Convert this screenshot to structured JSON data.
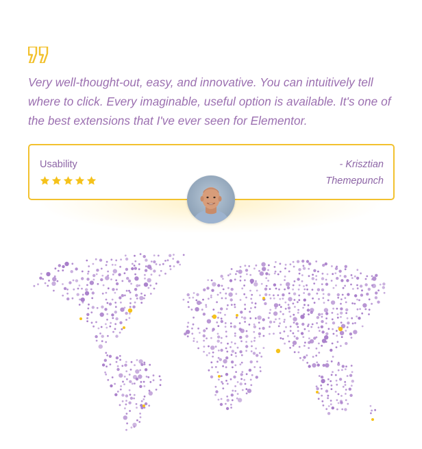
{
  "testimonial": {
    "quote_icon": "quote-mark-icon",
    "quote": "Very well-thought-out, easy, and innovative. You can intuitively tell where to click. Every imaginable, useful option is available. It's one of the best extensions that I've ever seen for Elementor.",
    "category_label": "Usability",
    "rating": 5,
    "rating_max": 5,
    "author": "- Krisztian",
    "company": "Themepunch",
    "avatar_icon": "author-avatar"
  },
  "map": {
    "icon": "world-map-dots",
    "dot_color": "#a77cc9",
    "highlight_color": "#f5c21b"
  },
  "colors": {
    "text": "#9b6fb0",
    "accent": "#f2c12e",
    "star": "#f5c21b"
  }
}
